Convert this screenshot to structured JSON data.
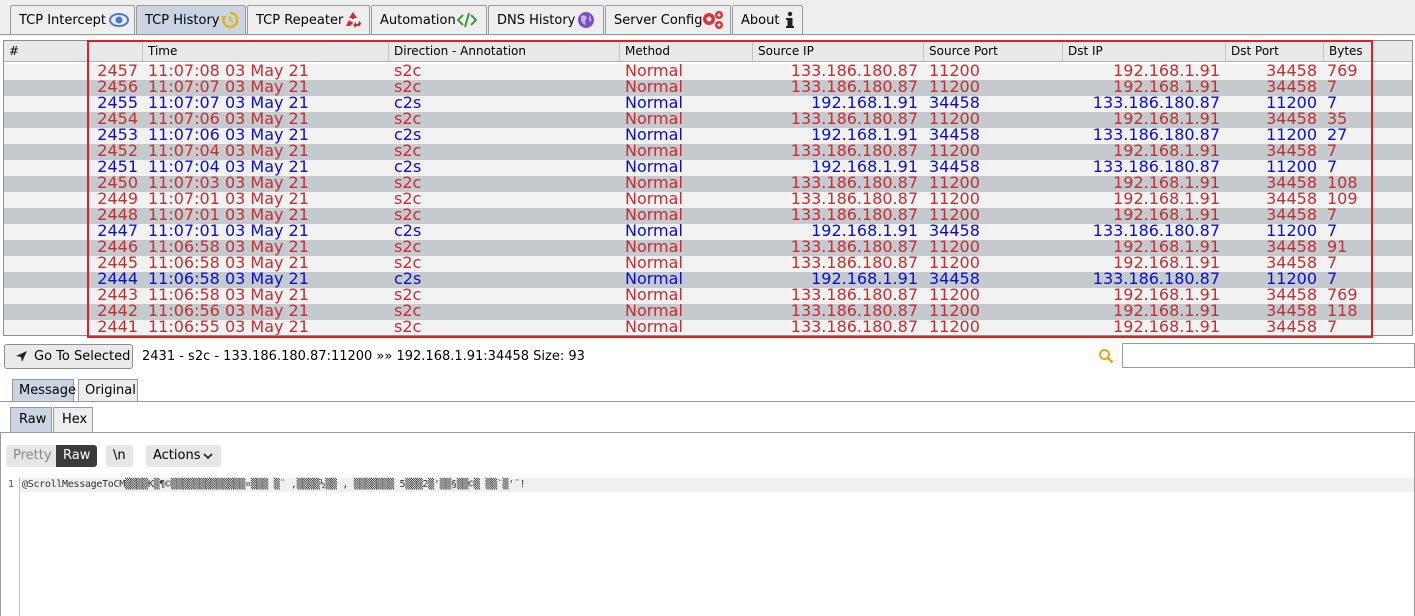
{
  "tabs": [
    {
      "label": "TCP Intercept",
      "icon": "eye-icon"
    },
    {
      "label": "TCP History",
      "icon": "history-icon"
    },
    {
      "label": "TCP Repeater",
      "icon": "recycle-icon"
    },
    {
      "label": "Automation",
      "icon": "code-icon"
    },
    {
      "label": "DNS History",
      "icon": "globe-icon"
    },
    {
      "label": "Server Config",
      "icon": "gears-icon"
    },
    {
      "label": "About",
      "icon": "info-icon"
    }
  ],
  "active_tab": "TCP History",
  "colors": {
    "s2c": "#c0302f",
    "c2s": "#0d0dc6",
    "highlight_box": "#e02020",
    "active_tab": "#c9d5e3"
  },
  "table": {
    "columns": [
      "#",
      "Time",
      "Direction - Annotation",
      "Method",
      "Source IP",
      "Source Port",
      "Dst IP",
      "Dst Port",
      "Bytes"
    ],
    "rows": [
      {
        "id": "2457",
        "time": "11:07:08 03 May 21",
        "dir": "s2c",
        "method": "Normal",
        "src_ip": "133.186.180.87",
        "src_port": "11200",
        "dst_ip": "192.168.1.91",
        "dst_port": "34458",
        "bytes": "769"
      },
      {
        "id": "2456",
        "time": "11:07:07 03 May 21",
        "dir": "s2c",
        "method": "Normal",
        "src_ip": "133.186.180.87",
        "src_port": "11200",
        "dst_ip": "192.168.1.91",
        "dst_port": "34458",
        "bytes": "7"
      },
      {
        "id": "2455",
        "time": "11:07:07 03 May 21",
        "dir": "c2s",
        "method": "Normal",
        "src_ip": "192.168.1.91",
        "src_port": "34458",
        "dst_ip": "133.186.180.87",
        "dst_port": "11200",
        "bytes": "7"
      },
      {
        "id": "2454",
        "time": "11:07:06 03 May 21",
        "dir": "s2c",
        "method": "Normal",
        "src_ip": "133.186.180.87",
        "src_port": "11200",
        "dst_ip": "192.168.1.91",
        "dst_port": "34458",
        "bytes": "35"
      },
      {
        "id": "2453",
        "time": "11:07:06 03 May 21",
        "dir": "c2s",
        "method": "Normal",
        "src_ip": "192.168.1.91",
        "src_port": "34458",
        "dst_ip": "133.186.180.87",
        "dst_port": "11200",
        "bytes": "27"
      },
      {
        "id": "2452",
        "time": "11:07:04 03 May 21",
        "dir": "s2c",
        "method": "Normal",
        "src_ip": "133.186.180.87",
        "src_port": "11200",
        "dst_ip": "192.168.1.91",
        "dst_port": "34458",
        "bytes": "7"
      },
      {
        "id": "2451",
        "time": "11:07:04 03 May 21",
        "dir": "c2s",
        "method": "Normal",
        "src_ip": "192.168.1.91",
        "src_port": "34458",
        "dst_ip": "133.186.180.87",
        "dst_port": "11200",
        "bytes": "7"
      },
      {
        "id": "2450",
        "time": "11:07:03 03 May 21",
        "dir": "s2c",
        "method": "Normal",
        "src_ip": "133.186.180.87",
        "src_port": "11200",
        "dst_ip": "192.168.1.91",
        "dst_port": "34458",
        "bytes": "108"
      },
      {
        "id": "2449",
        "time": "11:07:01 03 May 21",
        "dir": "s2c",
        "method": "Normal",
        "src_ip": "133.186.180.87",
        "src_port": "11200",
        "dst_ip": "192.168.1.91",
        "dst_port": "34458",
        "bytes": "109"
      },
      {
        "id": "2448",
        "time": "11:07:01 03 May 21",
        "dir": "s2c",
        "method": "Normal",
        "src_ip": "133.186.180.87",
        "src_port": "11200",
        "dst_ip": "192.168.1.91",
        "dst_port": "34458",
        "bytes": "7"
      },
      {
        "id": "2447",
        "time": "11:07:01 03 May 21",
        "dir": "c2s",
        "method": "Normal",
        "src_ip": "192.168.1.91",
        "src_port": "34458",
        "dst_ip": "133.186.180.87",
        "dst_port": "11200",
        "bytes": "7"
      },
      {
        "id": "2446",
        "time": "11:06:58 03 May 21",
        "dir": "s2c",
        "method": "Normal",
        "src_ip": "133.186.180.87",
        "src_port": "11200",
        "dst_ip": "192.168.1.91",
        "dst_port": "34458",
        "bytes": "91"
      },
      {
        "id": "2445",
        "time": "11:06:58 03 May 21",
        "dir": "s2c",
        "method": "Normal",
        "src_ip": "133.186.180.87",
        "src_port": "11200",
        "dst_ip": "192.168.1.91",
        "dst_port": "34458",
        "bytes": "7"
      },
      {
        "id": "2444",
        "time": "11:06:58 03 May 21",
        "dir": "c2s",
        "method": "Normal",
        "src_ip": "192.168.1.91",
        "src_port": "34458",
        "dst_ip": "133.186.180.87",
        "dst_port": "11200",
        "bytes": "7"
      },
      {
        "id": "2443",
        "time": "11:06:58 03 May 21",
        "dir": "s2c",
        "method": "Normal",
        "src_ip": "133.186.180.87",
        "src_port": "11200",
        "dst_ip": "192.168.1.91",
        "dst_port": "34458",
        "bytes": "769"
      },
      {
        "id": "2442",
        "time": "11:06:56 03 May 21",
        "dir": "s2c",
        "method": "Normal",
        "src_ip": "133.186.180.87",
        "src_port": "11200",
        "dst_ip": "192.168.1.91",
        "dst_port": "34458",
        "bytes": "118"
      },
      {
        "id": "2441",
        "time": "11:06:55 03 May 21",
        "dir": "s2c",
        "method": "Normal",
        "src_ip": "133.186.180.87",
        "src_port": "11200",
        "dst_ip": "192.168.1.91",
        "dst_port": "34458",
        "bytes": "7"
      }
    ]
  },
  "toolbar": {
    "goto_label": "Go To Selected",
    "selection_text": "2431 - s2c - 133.186.180.87:11200 »» 192.168.1.91:34458 Size: 93",
    "search_value": ""
  },
  "message_tabs": [
    "Message",
    "Original"
  ],
  "format_tabs": [
    "Raw",
    "Hex"
  ],
  "editor": {
    "pretty_label": "Pretty",
    "raw_label": "Raw",
    "newline_label": "\\n",
    "actions_label": "Actions",
    "line_number": "1",
    "content": "@ScrollMessageToCM▒▒▒▒K▒¶©▒▒▒▒▒▒▒▒▒▒▒▒▒¤▒▒▒ ▒¨ ,▒▒▒▒½▒▒ , ▒▒▒▒▒▒▒ 5▒▒▒2▒'▒▒§▒▒©▒ ▒▒`▒'¨!"
  }
}
